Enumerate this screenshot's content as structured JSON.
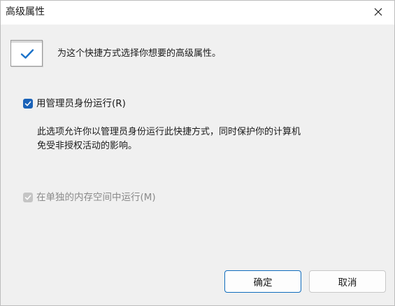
{
  "window": {
    "title": "高级属性",
    "close_icon": "close-icon"
  },
  "banner": {
    "icon": "checkmark-icon",
    "text": "为这个快捷方式选择你想要的高级属性。"
  },
  "options": {
    "run_as_admin": {
      "label": "用管理员身份运行(R)",
      "checked": true,
      "enabled": true
    },
    "description_line1": "此选项允许你以管理员身份运行此快捷方式，同时保护你的计算机",
    "description_line2": "免受非授权活动的影响。",
    "separate_memory": {
      "label": "在单独的内存空间中运行(M)",
      "checked": true,
      "enabled": false
    }
  },
  "buttons": {
    "ok_label": "确定",
    "cancel_label": "取消"
  },
  "colors": {
    "accent": "#1a62b8",
    "ok_border": "#0f6cbd",
    "disabled_text": "#8a8a8a",
    "background": "#f0f0f0"
  }
}
